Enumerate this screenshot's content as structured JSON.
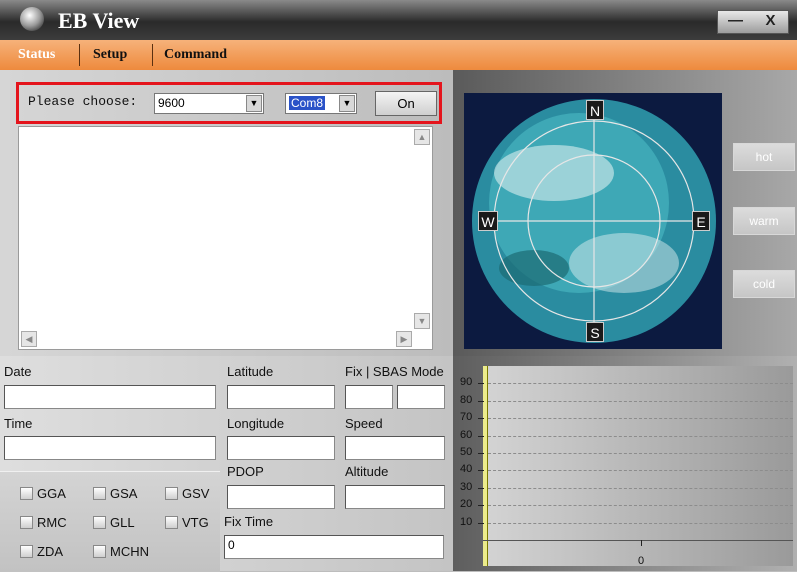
{
  "window": {
    "title": "EB View",
    "minimize_glyph": "—",
    "close_glyph": "X"
  },
  "menu": {
    "status": "Status",
    "setup": "Setup",
    "command": "Command"
  },
  "connection": {
    "prompt": "Please choose:",
    "baud_rate": "9600",
    "port": "Com8",
    "on_button": "On"
  },
  "compass": {
    "north": "N",
    "south": "S",
    "east": "E",
    "west": "W"
  },
  "restart_buttons": {
    "hot": "hot",
    "warm": "warm",
    "cold": "cold"
  },
  "fields": {
    "date": {
      "label": "Date",
      "value": ""
    },
    "time": {
      "label": "Time",
      "value": ""
    },
    "latitude": {
      "label": "Latitude",
      "value": ""
    },
    "longitude": {
      "label": "Longitude",
      "value": ""
    },
    "pdop": {
      "label": "PDOP",
      "value": ""
    },
    "fix_time": {
      "label": "Fix Time",
      "value": "0"
    },
    "fix_sbas": {
      "label": "Fix | SBAS Mode",
      "fix": "",
      "sbas": ""
    },
    "speed": {
      "label": "Speed",
      "value": ""
    },
    "altitude": {
      "label": "Altitude",
      "value": ""
    }
  },
  "nmea_checkboxes": [
    "GGA",
    "GSA",
    "GSV",
    "RMC",
    "GLL",
    "VTG",
    "ZDA",
    "MCHN"
  ],
  "chart_data": {
    "type": "bar",
    "y_ticks": [
      90,
      80,
      70,
      60,
      50,
      40,
      30,
      20,
      10
    ],
    "x_tick": "0",
    "categories": [],
    "values": []
  }
}
